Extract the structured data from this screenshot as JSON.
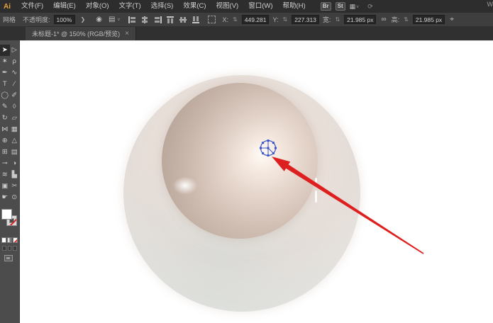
{
  "app": {
    "logo_text": "Ai"
  },
  "menubar": {
    "items": [
      "文件(F)",
      "编辑(E)",
      "对象(O)",
      "文字(T)",
      "选择(S)",
      "效果(C)",
      "视图(V)",
      "窗口(W)",
      "帮助(H)"
    ],
    "bridge_badge": "Br",
    "stock_badge": "St",
    "workspace_glyph": "▦",
    "caret": "˅",
    "sync_glyph": "⟳",
    "right_partial_text": "W"
  },
  "controlbar": {
    "selection_type": "网格",
    "opacity_label": "不透明度:",
    "opacity_value": "100%",
    "opacity_drop": "❯",
    "recolor_glyph": "◉",
    "style_glyph": "▤",
    "style_caret": "˅",
    "align_icons": [
      {
        "name": "align-horizontal-left-icon",
        "cls": "al-hl"
      },
      {
        "name": "align-horizontal-center-icon",
        "cls": "al-hc"
      },
      {
        "name": "align-horizontal-right-icon",
        "cls": "al-hr"
      },
      {
        "name": "align-vertical-top-icon",
        "cls": "al-vt"
      },
      {
        "name": "align-vertical-middle-icon",
        "cls": "al-vm"
      },
      {
        "name": "align-vertical-bottom-icon",
        "cls": "al-vb"
      }
    ],
    "stepper_glyph": "⇅",
    "x_label": "X:",
    "x_value": "449.281",
    "y_label": "Y:",
    "y_value": "227.313",
    "w_label": "宽:",
    "w_value": "21.985 px",
    "link_glyph": "∞",
    "h_label": "高:",
    "h_value": "21.985 px",
    "transform_glyph": "⌖"
  },
  "tabbar": {
    "title": "未标题-1* @ 150% (RGB/预览)",
    "close_glyph": "×"
  },
  "toolbar": {
    "rows": [
      {
        "left": {
          "name": "selection-tool",
          "glyph": "➤",
          "active": true
        },
        "right": {
          "name": "direct-selection-tool",
          "glyph": "▷"
        }
      },
      {
        "left": {
          "name": "magic-wand-tool",
          "glyph": "✶"
        },
        "right": {
          "name": "lasso-tool",
          "glyph": "ρ"
        }
      },
      {
        "left": {
          "name": "pen-tool",
          "glyph": "✒"
        },
        "right": {
          "name": "curvature-tool",
          "glyph": "∿"
        }
      },
      {
        "left": {
          "name": "type-tool",
          "glyph": "T"
        },
        "right": {
          "name": "line-segment-tool",
          "glyph": "∕"
        }
      },
      {
        "left": {
          "name": "ellipse-tool",
          "glyph": "◯"
        },
        "right": {
          "name": "paintbrush-tool",
          "glyph": "✐"
        }
      },
      {
        "left": {
          "name": "pencil-tool",
          "glyph": "✎"
        },
        "right": {
          "name": "eraser-tool",
          "glyph": "◊"
        }
      },
      {
        "left": {
          "name": "rotate-tool",
          "glyph": "↻"
        },
        "right": {
          "name": "scale-tool",
          "glyph": "▱"
        }
      },
      {
        "left": {
          "name": "width-tool",
          "glyph": "⋈"
        },
        "right": {
          "name": "free-transform-tool",
          "glyph": "▦"
        }
      },
      {
        "left": {
          "name": "shape-builder-tool",
          "glyph": "⊕"
        },
        "right": {
          "name": "perspective-grid-tool",
          "glyph": "△"
        }
      },
      {
        "left": {
          "name": "mesh-tool",
          "glyph": "⊞"
        },
        "right": {
          "name": "gradient-tool",
          "glyph": "▤"
        }
      },
      {
        "left": {
          "name": "eyedropper-tool",
          "glyph": "⊸"
        },
        "right": {
          "name": "blend-tool",
          "glyph": "◑"
        }
      },
      {
        "left": {
          "name": "symbol-sprayer-tool",
          "glyph": "≋"
        },
        "right": {
          "name": "column-graph-tool",
          "glyph": "▙"
        }
      },
      {
        "left": {
          "name": "artboard-tool",
          "glyph": "▣"
        },
        "right": {
          "name": "slice-tool",
          "glyph": "✂"
        }
      },
      {
        "left": {
          "name": "hand-tool",
          "glyph": "☛"
        },
        "right": {
          "name": "zoom-tool",
          "glyph": "⊙"
        }
      }
    ]
  },
  "canvas": {
    "artwork": "pearl gradient-mesh drawing",
    "selected_object": "mesh circle anchor group"
  },
  "colors": {
    "mesh_blue": "#3a56c8",
    "arrow_red": "#dd1f1f",
    "pearl_body": "#d0bdb2",
    "pearl_dark_rim": "#b09a8e",
    "pearl_highlight": "#fffaf5",
    "outer_sphere": "#eae0da",
    "outer_bottom_tint": "#ccd6d3",
    "logo_amber": "#e8a33d"
  }
}
